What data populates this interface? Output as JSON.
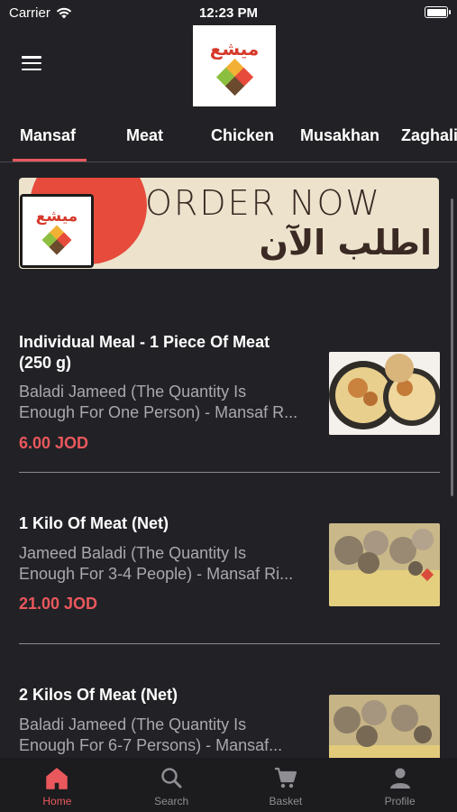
{
  "status_bar": {
    "carrier": "Carrier",
    "time": "12:23 PM"
  },
  "header": {
    "logo_text": "ميشع"
  },
  "tabs": [
    {
      "label": "Mansaf",
      "active": true
    },
    {
      "label": "Meat",
      "active": false
    },
    {
      "label": "Chicken",
      "active": false
    },
    {
      "label": "Musakhan",
      "active": false
    },
    {
      "label": "Zaghalil",
      "active": false
    }
  ],
  "banner": {
    "english": "ORDER NOW",
    "arabic": "اطلب الآن",
    "logo_text": "ميشع"
  },
  "meals": [
    {
      "name_line1": "Individual Meal - 1 Piece Of Meat",
      "name_line2": "(250 g)",
      "desc_line1": "Baladi Jameed (The Quantity Is",
      "desc_line2": "Enough For One Person) - Mansaf R...",
      "price": "6.00 JOD"
    },
    {
      "name_line1": "1 Kilo Of Meat (Net)",
      "desc_line1": "Jameed Baladi (The Quantity Is",
      "desc_line2": "Enough For 3-4 People) - Mansaf Ri...",
      "price": "21.00 JOD"
    },
    {
      "name_line1": "2 Kilos Of Meat (Net)",
      "desc_line1": "Baladi Jameed (The Quantity Is",
      "desc_line2": "Enough For 6-7 Persons) - Mansaf..."
    }
  ],
  "bottom_nav": [
    {
      "label": "Home",
      "icon": "home-icon",
      "active": true
    },
    {
      "label": "Search",
      "icon": "search-icon",
      "active": false
    },
    {
      "label": "Basket",
      "icon": "cart-icon",
      "active": false
    },
    {
      "label": "Profile",
      "icon": "profile-icon",
      "active": false
    }
  ],
  "colors": {
    "background": "#222226",
    "accent": "#e9585c",
    "muted_text": "#a9a9ad",
    "nav_background": "#1c1c1f"
  }
}
